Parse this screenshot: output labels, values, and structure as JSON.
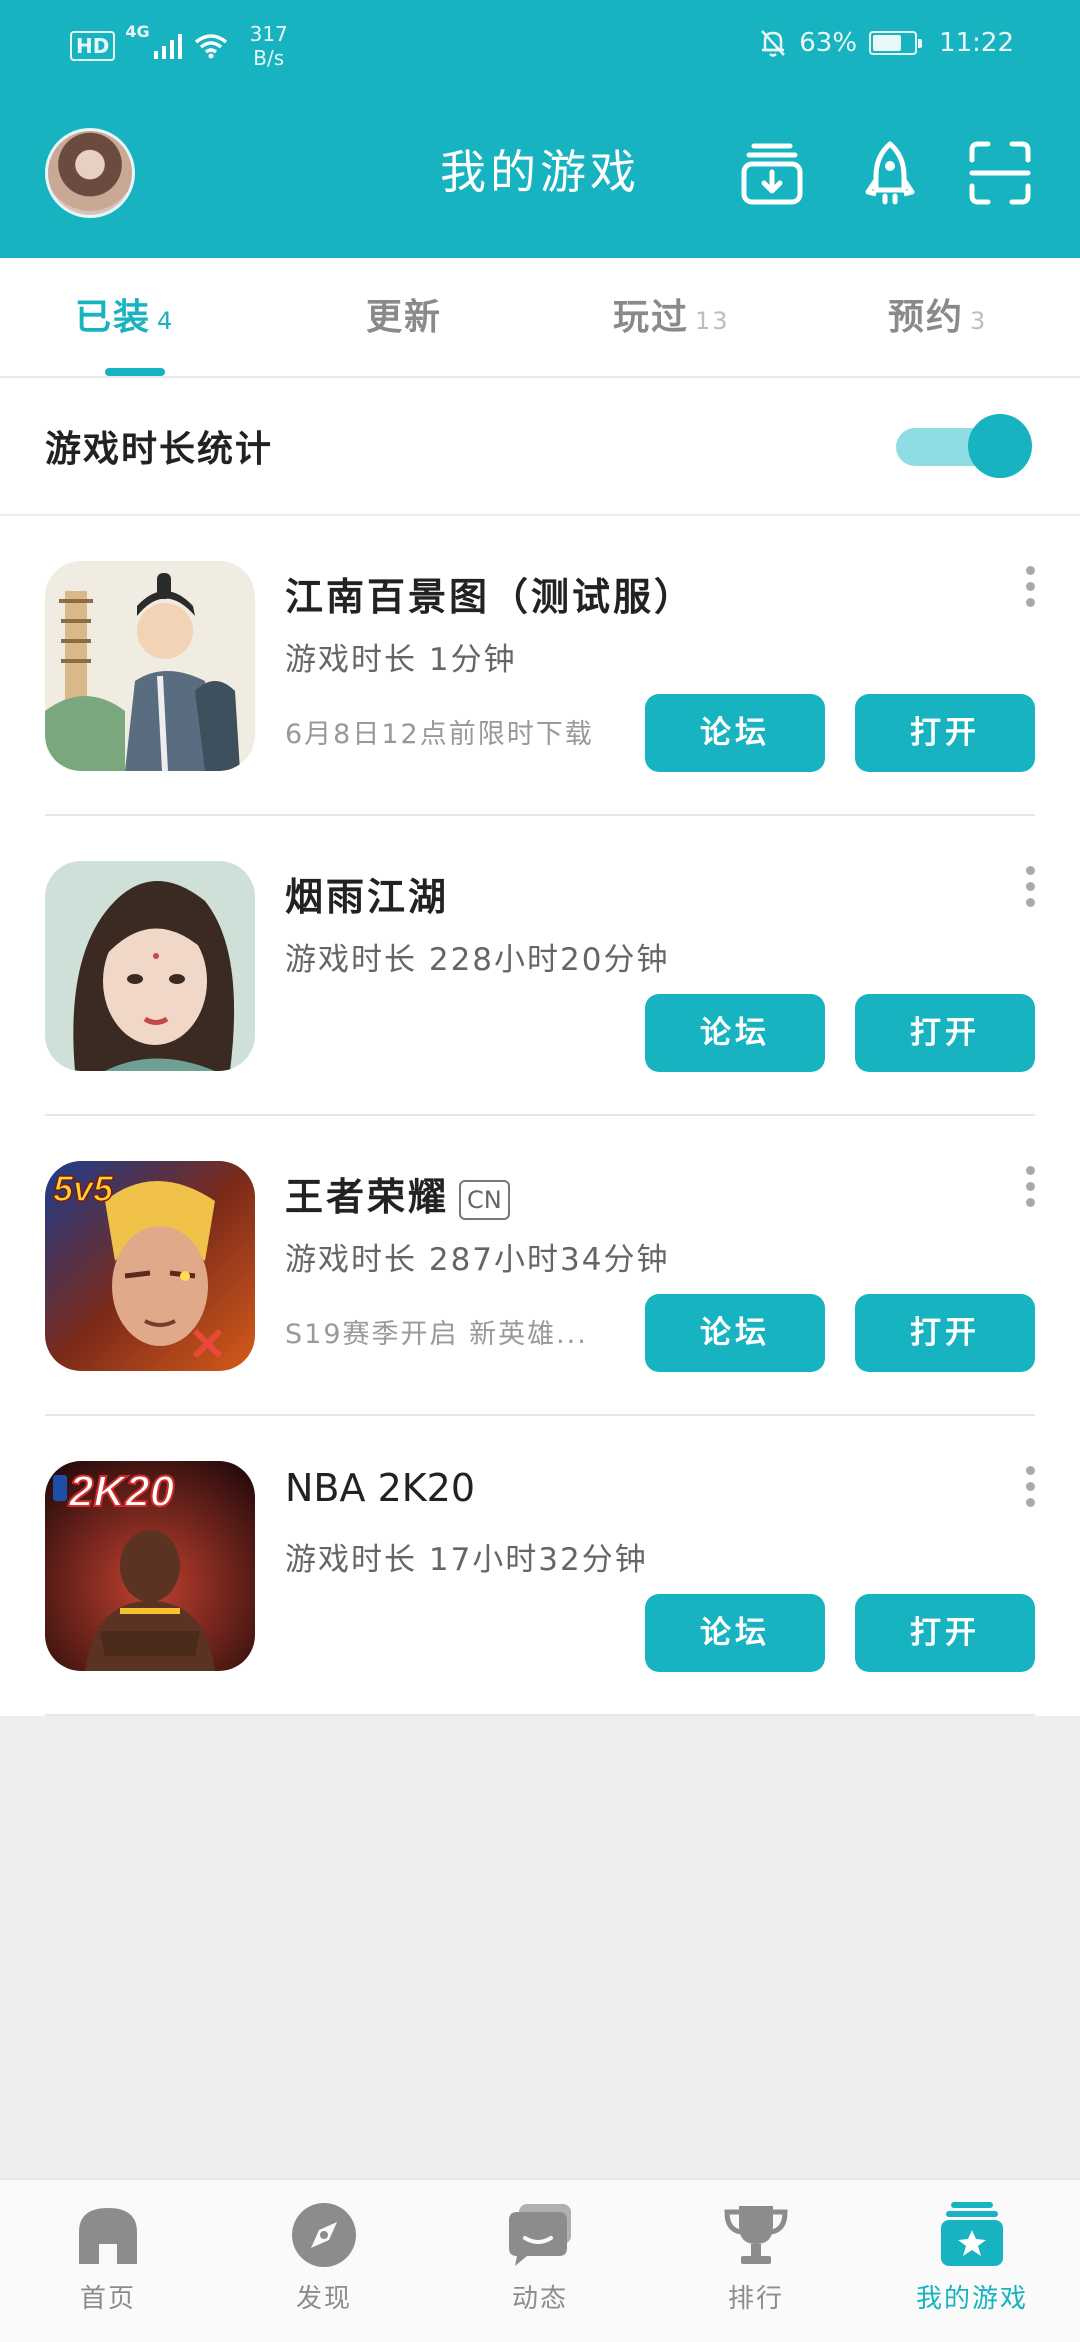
{
  "status_bar": {
    "hd": "HD",
    "network": "4G",
    "speed_value": "317",
    "speed_unit": "B/s",
    "battery": "63%",
    "time": "11:22"
  },
  "header": {
    "title": "我的游戏"
  },
  "tabs": [
    {
      "label": "已装",
      "count": "4",
      "active": true
    },
    {
      "label": "更新",
      "count": ""
    },
    {
      "label": "玩过",
      "count": "13"
    },
    {
      "label": "预约",
      "count": "3"
    }
  ],
  "stats": {
    "label": "游戏时长统计",
    "enabled": true
  },
  "games": [
    {
      "name": "江南百景图（测试服）",
      "tag": "",
      "playtime": "游戏时长 1分钟",
      "note": "6月8日12点前限时下载",
      "forum_label": "论坛",
      "open_label": "打开"
    },
    {
      "name": "烟雨江湖",
      "tag": "",
      "playtime": "游戏时长 228小时20分钟",
      "note": "",
      "forum_label": "论坛",
      "open_label": "打开"
    },
    {
      "name": "王者荣耀",
      "tag": "CN",
      "playtime": "游戏时长 287小时34分钟",
      "note": "S19赛季开启 新英雄...",
      "forum_label": "论坛",
      "open_label": "打开"
    },
    {
      "name": "NBA 2K20",
      "tag": "",
      "playtime": "游戏时长 17小时32分钟",
      "note": "",
      "forum_label": "论坛",
      "open_label": "打开"
    }
  ],
  "icon_texts": {
    "wzry": "5v5",
    "nba": "2K20"
  },
  "bottom_nav": [
    {
      "label": "首页",
      "icon": "home-icon"
    },
    {
      "label": "发现",
      "icon": "compass-icon"
    },
    {
      "label": "动态",
      "icon": "chat-icon"
    },
    {
      "label": "排行",
      "icon": "trophy-icon"
    },
    {
      "label": "我的游戏",
      "icon": "my-games-icon",
      "active": true
    }
  ],
  "colors": {
    "accent": "#17b3c1",
    "accent_light": "#8fdde4",
    "inactive": "#8c8c8c"
  }
}
